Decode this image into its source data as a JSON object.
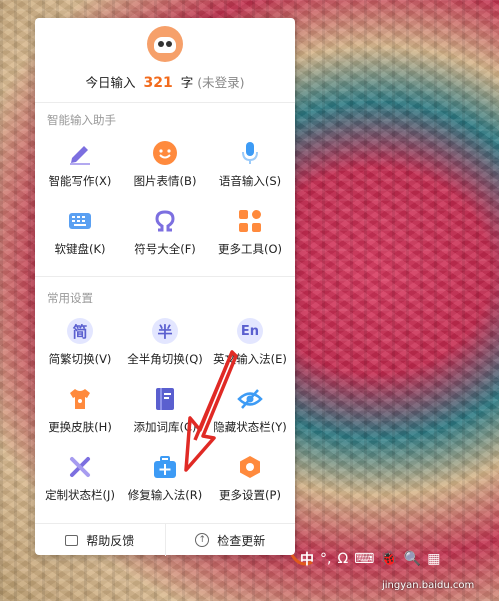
{
  "header": {
    "prefix": "今日输入",
    "count": "321",
    "unit": "字",
    "login_status": "(未登录)"
  },
  "smart_section": {
    "title": "智能输入助手",
    "items": [
      {
        "label": "智能写作(X)",
        "icon": "pen-icon"
      },
      {
        "label": "图片表情(B)",
        "icon": "smiley-icon"
      },
      {
        "label": "语音输入(S)",
        "icon": "mic-icon"
      },
      {
        "label": "软键盘(K)",
        "icon": "keyboard-icon"
      },
      {
        "label": "符号大全(F)",
        "icon": "omega-icon"
      },
      {
        "label": "更多工具(O)",
        "icon": "grid-icon"
      }
    ]
  },
  "common_section": {
    "title": "常用设置",
    "items": [
      {
        "label": "简繁切换(V)",
        "glyph": "简",
        "icon": "simplified-traditional-icon"
      },
      {
        "label": "全半角切换(Q)",
        "glyph": "半",
        "icon": "half-width-icon"
      },
      {
        "label": "英文输入法(E)",
        "glyph": "En",
        "icon": "english-icon"
      },
      {
        "label": "更换皮肤(H)",
        "icon": "shirt-icon"
      },
      {
        "label": "添加词库(C)",
        "icon": "book-icon"
      },
      {
        "label": "隐藏状态栏(Y)",
        "icon": "eye-hidden-icon"
      },
      {
        "label": "定制状态栏(J)",
        "icon": "tools-icon"
      },
      {
        "label": "修复输入法(R)",
        "icon": "repair-kit-icon"
      },
      {
        "label": "更多设置(P)",
        "icon": "hexagon-gear-icon"
      }
    ]
  },
  "footer": {
    "help": "帮助反馈",
    "update": "检查更新"
  },
  "taskbar": {
    "mode": "中",
    "items": [
      "°,",
      "Ω",
      "⌨",
      "🐞",
      "🔍",
      "▦"
    ]
  },
  "watermark": "jingyan.baidu.com",
  "colors": {
    "accent": "#f26b1d",
    "icon_purple": "#6b6fd8",
    "icon_orange": "#ff8a3d",
    "icon_blue": "#3d9bf5",
    "arrow_red": "#e02a25"
  }
}
